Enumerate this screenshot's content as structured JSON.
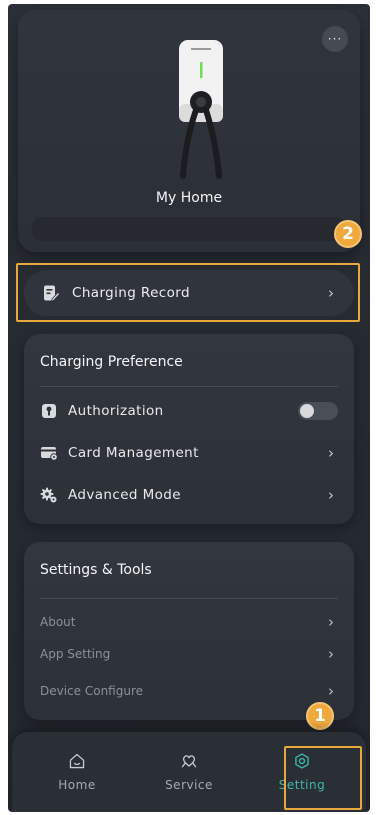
{
  "hero": {
    "home_name": "My Home",
    "more_label": "···"
  },
  "badges": {
    "first": "1",
    "second": "2"
  },
  "charging_record": {
    "label": "Charging Record",
    "icon": "document-edit-icon"
  },
  "charging_preference": {
    "title": "Charging Preference",
    "items": [
      {
        "label": "Authorization",
        "icon": "key-icon",
        "control": "toggle",
        "toggle_on": false
      },
      {
        "label": "Card Management",
        "icon": "card-icon",
        "control": "chevron"
      },
      {
        "label": "Advanced Mode",
        "icon": "gear-advanced-icon",
        "control": "chevron"
      }
    ]
  },
  "settings_tools": {
    "title": "Settings & Tools",
    "items": [
      {
        "label": "About"
      },
      {
        "label": "App Setting"
      },
      {
        "label": "Device Configure"
      }
    ]
  },
  "tabbar": {
    "tabs": [
      {
        "label": "Home",
        "icon": "home-icon",
        "active": false
      },
      {
        "label": "Service",
        "icon": "heart-hands-icon",
        "active": false
      },
      {
        "label": "Setting",
        "icon": "settings-gear-icon",
        "active": true
      }
    ]
  },
  "colors": {
    "accent": "#3fb7a8",
    "highlight": "#e8a83c",
    "badge": "#f0a93d",
    "background": "#2a2e35"
  }
}
